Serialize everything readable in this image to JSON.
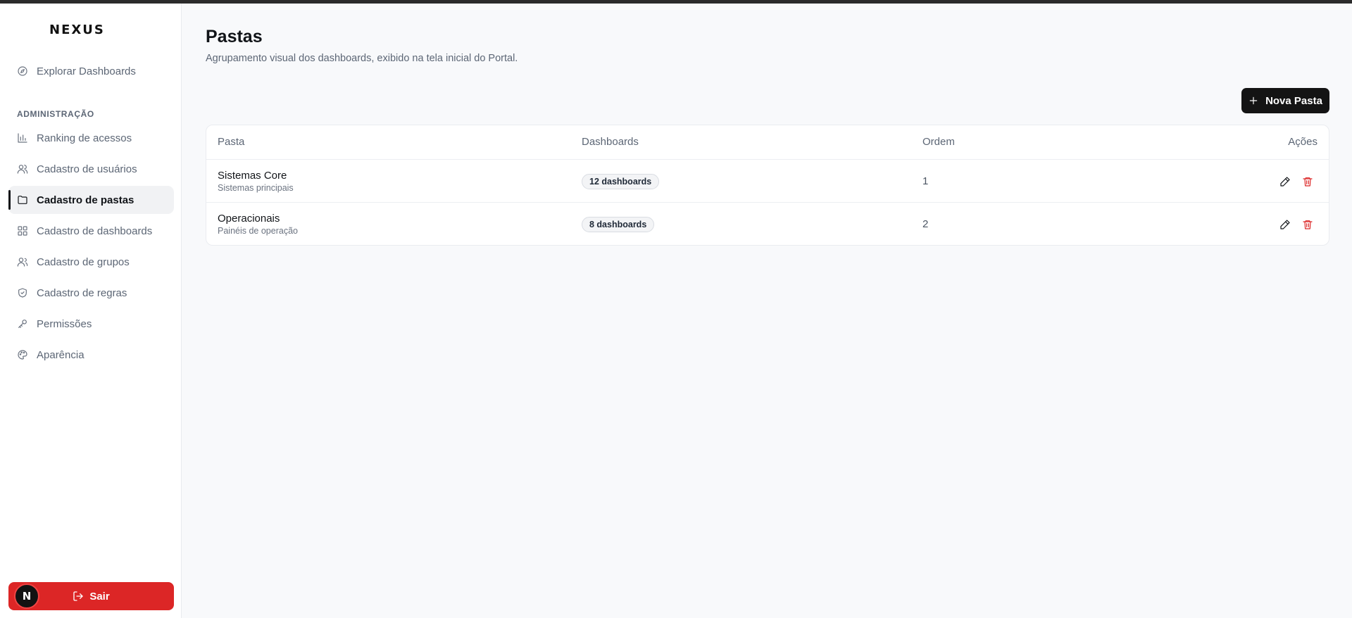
{
  "app": {
    "logo": "NEXUS"
  },
  "sidebar": {
    "explore_label": "Explorar Dashboards",
    "section_label": "ADMINISTRAÇÃO",
    "items": [
      {
        "label": "Ranking de acessos",
        "icon": "bar-chart-icon"
      },
      {
        "label": "Cadastro de usuários",
        "icon": "users-icon"
      },
      {
        "label": "Cadastro de pastas",
        "icon": "folder-icon",
        "active": true
      },
      {
        "label": "Cadastro de dashboards",
        "icon": "grid-icon"
      },
      {
        "label": "Cadastro de grupos",
        "icon": "group-icon"
      },
      {
        "label": "Cadastro de regras",
        "icon": "shield-check-icon"
      },
      {
        "label": "Permissões",
        "icon": "key-icon"
      },
      {
        "label": "Aparência",
        "icon": "palette-icon"
      }
    ],
    "logout_label": "Sair",
    "avatar_initial": "N"
  },
  "main": {
    "title": "Pastas",
    "subtitle": "Agrupamento visual dos dashboards, exibido na tela inicial do Portal.",
    "new_button_label": "Nova Pasta",
    "table": {
      "columns": [
        "Pasta",
        "Dashboards",
        "Ordem",
        "Ações"
      ],
      "rows": [
        {
          "name": "Sistemas Core",
          "description": "Sistemas principais",
          "dashboards": "12 dashboards",
          "order": "1"
        },
        {
          "name": "Operacionais",
          "description": "Painéis de operação",
          "dashboards": "8 dashboards",
          "order": "2"
        }
      ]
    }
  },
  "colors": {
    "accent": "#141414",
    "danger": "#dc2626",
    "background": "#f8f9fb"
  }
}
